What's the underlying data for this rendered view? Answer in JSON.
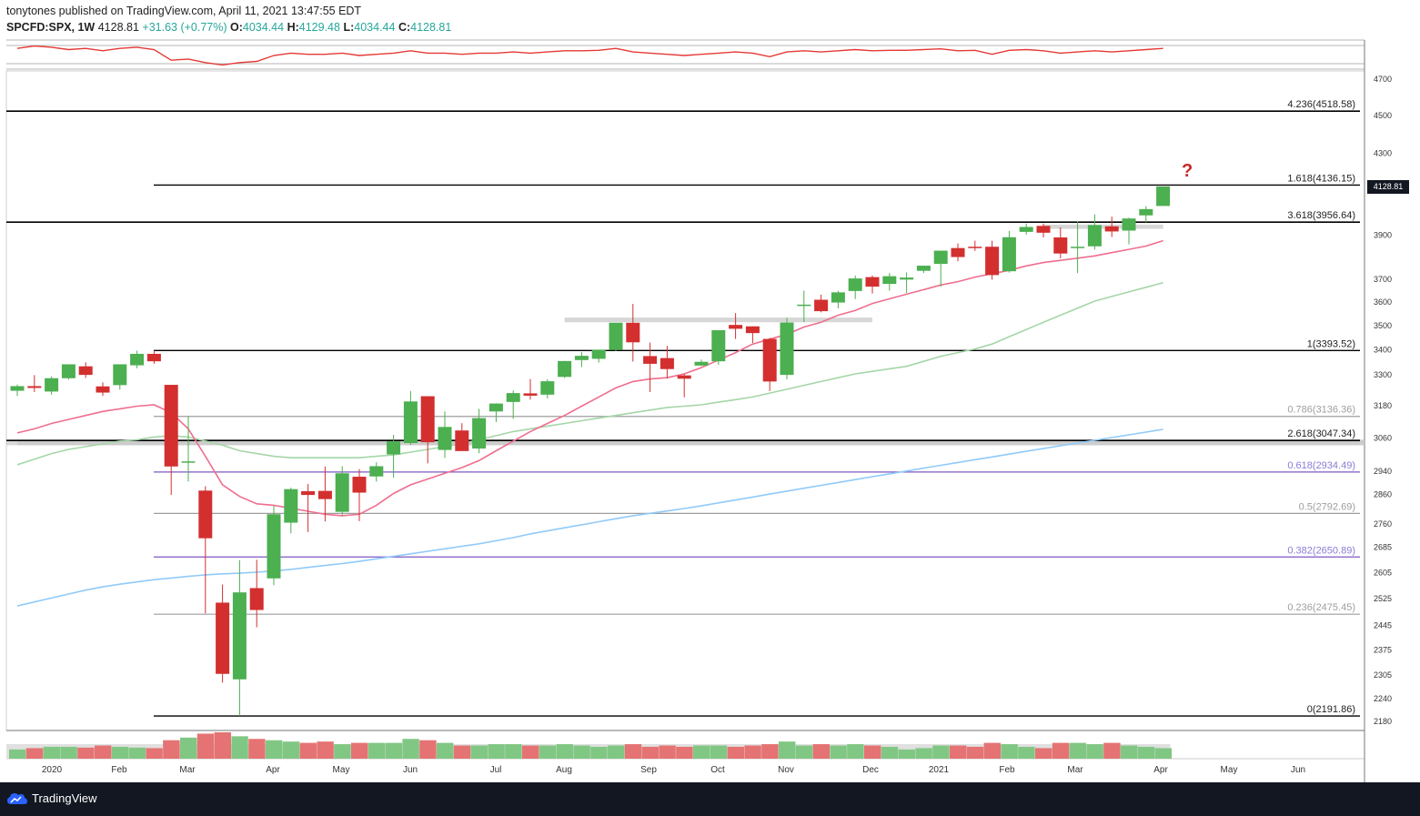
{
  "header": {
    "publisher_line": "tonytones published on TradingView.com, April 11, 2021 13:47:55 EDT",
    "symbol": "SPCFD:SPX, 1W",
    "close": "4128.81",
    "change": "+31.63 (+0.77%)",
    "open_label": "O:",
    "open": "4034.44",
    "high_label": "H:",
    "high": "4129.48",
    "low_label": "L:",
    "low": "4034.44",
    "close_label": "C:",
    "close_value": "4128.81"
  },
  "footer": {
    "brand": "TradingView"
  },
  "last_price_tag": "4128.81",
  "annotation": "?",
  "colors": {
    "up": "#4caf50",
    "down": "#d32f2f",
    "ma20": "#ef6e8e",
    "ma50": "#a5d6a7",
    "ma200": "#90caf9",
    "rsi": "#e53935",
    "fib_gray": "#9e9e9e",
    "fib_purple": "#7e57c2",
    "level": "#000000"
  },
  "chart_data": {
    "type": "candlestick",
    "y_axis": {
      "scale": "log",
      "ticks": [
        2180,
        2240,
        2305,
        2375,
        2445,
        2525,
        2605,
        2685,
        2760,
        2860,
        2940,
        3060,
        3180,
        3300,
        3400,
        3500,
        3600,
        3700,
        3900,
        4300,
        4500,
        4700
      ]
    },
    "x_axis": {
      "labels": [
        "2020",
        "Feb",
        "Mar",
        "Apr",
        "May",
        "Jun",
        "Jul",
        "Aug",
        "Sep",
        "Oct",
        "Nov",
        "Dec",
        "2021",
        "Feb",
        "Mar",
        "Apr",
        "May",
        "Jun"
      ]
    },
    "candles": [
      {
        "o": 3234,
        "h": 3258,
        "l": 3214,
        "c": 3252
      },
      {
        "o": 3252,
        "h": 3295,
        "l": 3229,
        "c": 3245
      },
      {
        "o": 3231,
        "h": 3290,
        "l": 3219,
        "c": 3283
      },
      {
        "o": 3283,
        "h": 3338,
        "l": 3278,
        "c": 3338
      },
      {
        "o": 3330,
        "h": 3346,
        "l": 3284,
        "c": 3296
      },
      {
        "o": 3251,
        "h": 3267,
        "l": 3214,
        "c": 3227
      },
      {
        "o": 3256,
        "h": 3338,
        "l": 3238,
        "c": 3338
      },
      {
        "o": 3334,
        "h": 3393,
        "l": 3322,
        "c": 3380
      },
      {
        "o": 3380,
        "h": 3393,
        "l": 3340,
        "c": 3350
      },
      {
        "o": 3257,
        "h": 3257,
        "l": 2855,
        "c": 2954
      },
      {
        "o": 2970,
        "h": 3136,
        "l": 2901,
        "c": 2972
      },
      {
        "o": 2870,
        "h": 2885,
        "l": 2478,
        "c": 2711
      },
      {
        "o": 2510,
        "h": 2565,
        "l": 2281,
        "c": 2305
      },
      {
        "o": 2290,
        "h": 2641,
        "l": 2192,
        "c": 2541
      },
      {
        "o": 2554,
        "h": 2642,
        "l": 2437,
        "c": 2488
      },
      {
        "o": 2584,
        "h": 2818,
        "l": 2563,
        "c": 2790
      },
      {
        "o": 2762,
        "h": 2880,
        "l": 2727,
        "c": 2875
      },
      {
        "o": 2868,
        "h": 2893,
        "l": 2731,
        "c": 2855
      },
      {
        "o": 2869,
        "h": 2954,
        "l": 2766,
        "c": 2841
      },
      {
        "o": 2798,
        "h": 2955,
        "l": 2786,
        "c": 2930
      },
      {
        "o": 2918,
        "h": 2945,
        "l": 2767,
        "c": 2863
      },
      {
        "o": 2919,
        "h": 2969,
        "l": 2901,
        "c": 2955
      },
      {
        "o": 2997,
        "h": 3068,
        "l": 2915,
        "c": 3044
      },
      {
        "o": 3038,
        "h": 3233,
        "l": 3031,
        "c": 3193
      },
      {
        "o": 3213,
        "h": 3213,
        "l": 2965,
        "c": 3041
      },
      {
        "o": 3013,
        "h": 3155,
        "l": 2984,
        "c": 3097
      },
      {
        "o": 3084,
        "h": 3111,
        "l": 3014,
        "c": 3009
      },
      {
        "o": 3018,
        "h": 3165,
        "l": 3001,
        "c": 3130
      },
      {
        "o": 3155,
        "h": 3186,
        "l": 3115,
        "c": 3185
      },
      {
        "o": 3191,
        "h": 3235,
        "l": 3127,
        "c": 3225
      },
      {
        "o": 3224,
        "h": 3280,
        "l": 3200,
        "c": 3215
      },
      {
        "o": 3219,
        "h": 3279,
        "l": 3204,
        "c": 3271
      },
      {
        "o": 3288,
        "h": 3352,
        "l": 3284,
        "c": 3351
      },
      {
        "o": 3355,
        "h": 3387,
        "l": 3327,
        "c": 3372
      },
      {
        "o": 3360,
        "h": 3396,
        "l": 3345,
        "c": 3397
      },
      {
        "o": 3396,
        "h": 3508,
        "l": 3391,
        "c": 3508
      },
      {
        "o": 3508,
        "h": 3588,
        "l": 3349,
        "c": 3427
      },
      {
        "o": 3371,
        "h": 3426,
        "l": 3229,
        "c": 3340
      },
      {
        "o": 3363,
        "h": 3412,
        "l": 3282,
        "c": 3319
      },
      {
        "o": 3294,
        "h": 3299,
        "l": 3209,
        "c": 3281
      },
      {
        "o": 3333,
        "h": 3357,
        "l": 3331,
        "c": 3348
      },
      {
        "o": 3350,
        "h": 3467,
        "l": 3336,
        "c": 3477
      },
      {
        "o": 3499,
        "h": 3549,
        "l": 3441,
        "c": 3483
      },
      {
        "o": 3493,
        "h": 3493,
        "l": 3424,
        "c": 3465
      },
      {
        "o": 3441,
        "h": 3445,
        "l": 3233,
        "c": 3270
      },
      {
        "o": 3296,
        "h": 3529,
        "l": 3279,
        "c": 3509
      },
      {
        "o": 3583,
        "h": 3646,
        "l": 3511,
        "c": 3585
      },
      {
        "o": 3606,
        "h": 3628,
        "l": 3552,
        "c": 3557
      },
      {
        "o": 3594,
        "h": 3645,
        "l": 3569,
        "c": 3638
      },
      {
        "o": 3644,
        "h": 3712,
        "l": 3609,
        "c": 3699
      },
      {
        "o": 3705,
        "h": 3712,
        "l": 3633,
        "c": 3663
      },
      {
        "o": 3675,
        "h": 3723,
        "l": 3645,
        "c": 3709
      },
      {
        "o": 3694,
        "h": 3726,
        "l": 3636,
        "c": 3703
      },
      {
        "o": 3733,
        "h": 3756,
        "l": 3723,
        "c": 3756
      },
      {
        "o": 3764,
        "h": 3824,
        "l": 3663,
        "c": 3824
      },
      {
        "o": 3836,
        "h": 3857,
        "l": 3776,
        "c": 3795
      },
      {
        "o": 3842,
        "h": 3870,
        "l": 3823,
        "c": 3841
      },
      {
        "o": 3842,
        "h": 3870,
        "l": 3694,
        "c": 3714
      },
      {
        "o": 3731,
        "h": 3915,
        "l": 3725,
        "c": 3886
      },
      {
        "o": 3911,
        "h": 3950,
        "l": 3898,
        "c": 3934
      },
      {
        "o": 3939,
        "h": 3950,
        "l": 3885,
        "c": 3907
      },
      {
        "o": 3885,
        "h": 3932,
        "l": 3789,
        "c": 3811
      },
      {
        "o": 3842,
        "h": 3960,
        "l": 3723,
        "c": 3842
      },
      {
        "o": 3844,
        "h": 3994,
        "l": 3829,
        "c": 3943
      },
      {
        "o": 3937,
        "h": 3983,
        "l": 3887,
        "c": 3913
      },
      {
        "o": 3917,
        "h": 3978,
        "l": 3853,
        "c": 3974
      },
      {
        "o": 3989,
        "h": 4033,
        "l": 3955,
        "c": 4019
      },
      {
        "o": 4034,
        "h": 4129,
        "l": 4034,
        "c": 4129
      }
    ],
    "fib_levels": [
      {
        "label": "4.236(4518.58)",
        "value": 4518.58
      },
      {
        "label": "1.618(4136.15)",
        "value": 4136.15
      },
      {
        "label": "3.618(3956.64)",
        "value": 3956.64
      },
      {
        "label": "1(3393.52)",
        "value": 3393.52
      },
      {
        "label": "0.786(3136.36)",
        "value": 3136.36
      },
      {
        "label": "2.618(3047.34)",
        "value": 3047.34
      },
      {
        "label": "0.618(2934.49)",
        "value": 2934.49
      },
      {
        "label": "0.5(2792.69)",
        "value": 2792.69
      },
      {
        "label": "0.382(2650.89)",
        "value": 2650.89
      },
      {
        "label": "0.236(2475.45)",
        "value": 2475.45
      },
      {
        "label": "0(2191.86)",
        "value": 2191.86
      }
    ],
    "resistance_zones": [
      {
        "start": 32,
        "end": 50,
        "low": 3510,
        "high": 3530
      },
      {
        "start": 60,
        "end": 67,
        "low": 3925,
        "high": 3945
      },
      {
        "start": 0,
        "end": 80,
        "low": 3030,
        "high": 3050
      }
    ],
    "ma20": [
      3075,
      3090,
      3110,
      3125,
      3140,
      3155,
      3165,
      3175,
      3180,
      3150,
      3090,
      2990,
      2890,
      2850,
      2825,
      2820,
      2810,
      2800,
      2790,
      2785,
      2790,
      2820,
      2860,
      2890,
      2910,
      2930,
      2950,
      2975,
      3010,
      3045,
      3080,
      3110,
      3140,
      3175,
      3210,
      3245,
      3270,
      3280,
      3285,
      3300,
      3325,
      3355,
      3385,
      3420,
      3440,
      3460,
      3490,
      3510,
      3540,
      3560,
      3590,
      3610,
      3630,
      3650,
      3670,
      3685,
      3705,
      3720,
      3735,
      3755,
      3770,
      3780,
      3790,
      3800,
      3815,
      3830,
      3845,
      3870
    ],
    "ma50": [
      2960,
      2980,
      3000,
      3015,
      3025,
      3035,
      3045,
      3050,
      3060,
      3065,
      3060,
      3045,
      3030,
      3010,
      3000,
      2990,
      2985,
      2985,
      2985,
      2985,
      2985,
      2990,
      2995,
      3005,
      3015,
      3025,
      3035,
      3050,
      3065,
      3080,
      3090,
      3100,
      3110,
      3120,
      3130,
      3140,
      3150,
      3160,
      3170,
      3175,
      3180,
      3190,
      3200,
      3210,
      3225,
      3240,
      3255,
      3270,
      3285,
      3300,
      3310,
      3320,
      3330,
      3350,
      3370,
      3385,
      3400,
      3420,
      3450,
      3480,
      3510,
      3540,
      3570,
      3600,
      3620,
      3640,
      3660,
      3680
    ],
    "ma200": [
      2500,
      2512,
      2524,
      2536,
      2548,
      2558,
      2566,
      2573,
      2580,
      2585,
      2590,
      2595,
      2598,
      2600,
      2603,
      2607,
      2612,
      2618,
      2624,
      2630,
      2637,
      2645,
      2653,
      2661,
      2669,
      2677,
      2685,
      2693,
      2703,
      2713,
      2725,
      2735,
      2745,
      2755,
      2765,
      2775,
      2785,
      2793,
      2801,
      2809,
      2818,
      2828,
      2838,
      2848,
      2858,
      2868,
      2878,
      2888,
      2898,
      2908,
      2918,
      2928,
      2938,
      2948,
      2958,
      2968,
      2978,
      2988,
      2998,
      3008,
      3018,
      3028,
      3038,
      3048,
      3058,
      3068,
      3078,
      3088
    ],
    "volume": [
      0.35,
      0.4,
      0.45,
      0.45,
      0.42,
      0.5,
      0.45,
      0.42,
      0.4,
      0.7,
      0.8,
      0.95,
      1.0,
      0.85,
      0.75,
      0.7,
      0.65,
      0.6,
      0.65,
      0.55,
      0.6,
      0.6,
      0.6,
      0.75,
      0.7,
      0.6,
      0.5,
      0.5,
      0.55,
      0.55,
      0.5,
      0.5,
      0.55,
      0.5,
      0.45,
      0.5,
      0.55,
      0.45,
      0.5,
      0.45,
      0.5,
      0.5,
      0.45,
      0.5,
      0.55,
      0.65,
      0.5,
      0.55,
      0.5,
      0.55,
      0.5,
      0.45,
      0.35,
      0.4,
      0.5,
      0.5,
      0.45,
      0.6,
      0.55,
      0.45,
      0.4,
      0.6,
      0.6,
      0.55,
      0.6,
      0.5,
      0.45,
      0.4
    ],
    "rsi": [
      0.8,
      0.9,
      0.85,
      0.75,
      0.8,
      0.7,
      0.8,
      0.85,
      0.75,
      0.3,
      0.35,
      0.2,
      0.1,
      0.2,
      0.25,
      0.5,
      0.6,
      0.55,
      0.55,
      0.6,
      0.5,
      0.55,
      0.6,
      0.7,
      0.6,
      0.6,
      0.55,
      0.6,
      0.6,
      0.65,
      0.6,
      0.65,
      0.7,
      0.7,
      0.72,
      0.8,
      0.65,
      0.6,
      0.55,
      0.5,
      0.55,
      0.6,
      0.65,
      0.6,
      0.45,
      0.65,
      0.7,
      0.65,
      0.7,
      0.75,
      0.7,
      0.72,
      0.72,
      0.75,
      0.78,
      0.7,
      0.72,
      0.55,
      0.72,
      0.75,
      0.7,
      0.6,
      0.65,
      0.7,
      0.65,
      0.7,
      0.75,
      0.8
    ]
  }
}
